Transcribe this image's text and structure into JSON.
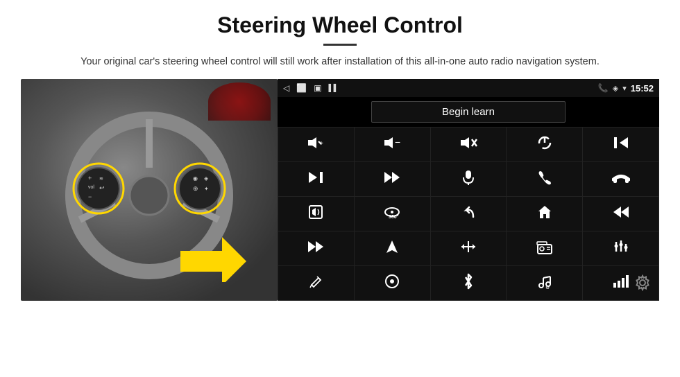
{
  "header": {
    "title": "Steering Wheel Control",
    "subtitle": "Your original car's steering wheel control will still work after installation of this all-in-one auto radio navigation system."
  },
  "statusBar": {
    "time": "15:52",
    "backIcon": "◁",
    "homeIcon": "□",
    "recentIcon": "◻",
    "signalIcon": "▌▌",
    "phoneIcon": "📞",
    "locationIcon": "◈",
    "wifiIcon": "▾"
  },
  "beginLearn": {
    "label": "Begin learn"
  },
  "controls": [
    {
      "icon": "🔊+",
      "name": "volume-up"
    },
    {
      "icon": "🔊−",
      "name": "volume-down"
    },
    {
      "icon": "🔇",
      "name": "mute"
    },
    {
      "icon": "⏻",
      "name": "power"
    },
    {
      "icon": "⏮",
      "name": "prev-track"
    },
    {
      "icon": "⏭",
      "name": "next-track-skip"
    },
    {
      "icon": "⏩",
      "name": "fast-forward"
    },
    {
      "icon": "🎤",
      "name": "microphone"
    },
    {
      "icon": "📞",
      "name": "phone-call"
    },
    {
      "icon": "📵",
      "name": "hang-up"
    },
    {
      "icon": "📢",
      "name": "speaker"
    },
    {
      "icon": "360",
      "name": "360-view"
    },
    {
      "icon": "↩",
      "name": "back"
    },
    {
      "icon": "🏠",
      "name": "home"
    },
    {
      "icon": "⏮⏮",
      "name": "rewind"
    },
    {
      "icon": "⏭⏭",
      "name": "skip-forward"
    },
    {
      "icon": "▶",
      "name": "navigate"
    },
    {
      "icon": "⇌",
      "name": "swap"
    },
    {
      "icon": "📻",
      "name": "radio"
    },
    {
      "icon": "🎛",
      "name": "equalizer"
    },
    {
      "icon": "✏",
      "name": "edit"
    },
    {
      "icon": "⊙",
      "name": "circle-dot"
    },
    {
      "icon": "✱",
      "name": "bluetooth"
    },
    {
      "icon": "🎵",
      "name": "music"
    },
    {
      "icon": "📶",
      "name": "signal-bars"
    }
  ],
  "settings": {
    "gearIcon": "⚙"
  }
}
